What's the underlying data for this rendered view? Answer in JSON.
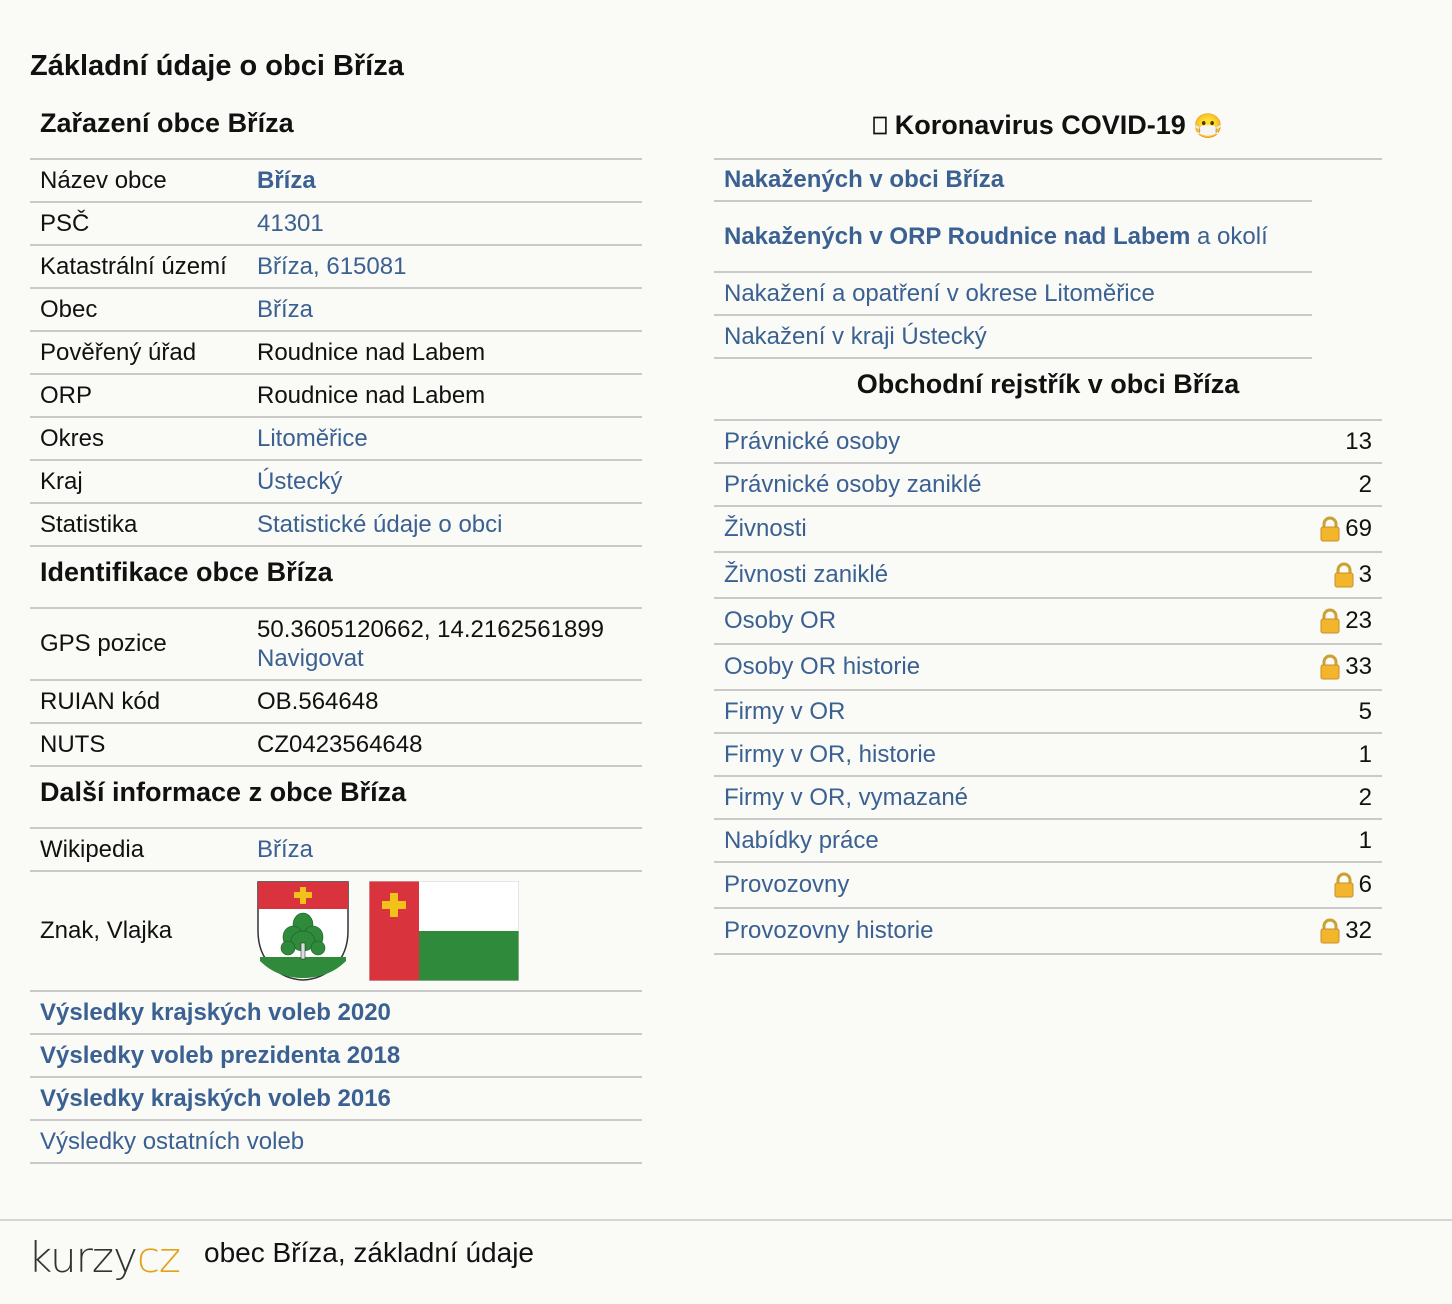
{
  "page_title": "Základní údaje o obci Bříza",
  "zarazeni": {
    "title": "Zařazení obce Bříza",
    "rows": [
      {
        "key": "Název obce",
        "value": "Bříza",
        "link": true,
        "bold": true
      },
      {
        "key": "PSČ",
        "value": "41301",
        "link": true
      },
      {
        "key": "Katastrální území",
        "value": "Bříza, 615081",
        "link": true
      },
      {
        "key": "Obec",
        "value": "Bříza",
        "link": true
      },
      {
        "key": "Pověřený úřad",
        "value": "Roudnice nad Labem",
        "link": false
      },
      {
        "key": "ORP",
        "value": "Roudnice nad Labem",
        "link": false
      },
      {
        "key": "Okres",
        "value": "Litoměřice",
        "link": true
      },
      {
        "key": "Kraj",
        "value": "Ústecký",
        "link": true
      },
      {
        "key": "Statistika",
        "value": "Statistické údaje o obci",
        "link": true
      }
    ]
  },
  "identifikace": {
    "title": "Identifikace obce Bříza",
    "gps_key": "GPS pozice",
    "gps_value": "50.3605120662, 14.2162561899",
    "gps_nav": "Navigovat",
    "ruian_key": "RUIAN kód",
    "ruian_value": "OB.564648",
    "nuts_key": "NUTS",
    "nuts_value": "CZ0423564648"
  },
  "dalsi": {
    "title": "Další informace z obce Bříza",
    "wiki_key": "Wikipedia",
    "wiki_value": "Bříza",
    "znak_key": "Znak, Vlajka"
  },
  "volby": [
    {
      "label": "Výsledky krajských voleb 2020",
      "bold": true
    },
    {
      "label": "Výsledky voleb prezidenta 2018",
      "bold": true
    },
    {
      "label": "Výsledky krajských voleb 2016",
      "bold": true
    },
    {
      "label": "Výsledky ostatních voleb",
      "bold": false
    }
  ],
  "covid": {
    "title": "Koronavirus COVID-19",
    "title_prefix": "⎕",
    "title_emoji": "😷",
    "links": [
      {
        "parts": [
          {
            "text": "Nakažených v obci Bříza",
            "bold": true
          }
        ]
      },
      {
        "parts": [
          {
            "text": "Nakažených v ORP Roudnice nad Labem",
            "bold": true
          },
          {
            "text": " a okolí",
            "bold": false
          }
        ]
      },
      {
        "parts": [
          {
            "text": "Nakažení a opatření v okrese Litoměřice",
            "bold": false
          }
        ]
      },
      {
        "parts": [
          {
            "text": "Nakažení v kraji Ústecký",
            "bold": false
          }
        ]
      }
    ]
  },
  "rejstrik": {
    "title": "Obchodní rejstřík v obci Bříza",
    "rows": [
      {
        "label": "Právnické osoby",
        "value": "13",
        "lock": false
      },
      {
        "label": "Právnické osoby zaniklé",
        "value": "2",
        "lock": false
      },
      {
        "label": "Živnosti",
        "value": "69",
        "lock": true
      },
      {
        "label": "Živnosti zaniklé",
        "value": "3",
        "lock": true
      },
      {
        "label": "Osoby OR",
        "value": "23",
        "lock": true
      },
      {
        "label": "Osoby OR historie",
        "value": "33",
        "lock": true
      },
      {
        "label": "Firmy v OR",
        "value": "5",
        "lock": false
      },
      {
        "label": "Firmy v OR, historie",
        "value": "1",
        "lock": false
      },
      {
        "label": "Firmy v OR, vymazané",
        "value": "2",
        "lock": false
      },
      {
        "label": "Nabídky práce",
        "value": "1",
        "lock": false
      },
      {
        "label": "Provozovny",
        "value": "6",
        "lock": true
      },
      {
        "label": "Provozovny historie",
        "value": "32",
        "lock": true
      }
    ]
  },
  "footer": {
    "logo_part1": "kurzy",
    "logo_part2": "cz",
    "text": "obec Bříza, základní údaje"
  },
  "colors": {
    "link": "#3a6192",
    "logo_accent": "#e3a21a",
    "flag_red": "#d9343e",
    "flag_green": "#2f8a3b"
  }
}
